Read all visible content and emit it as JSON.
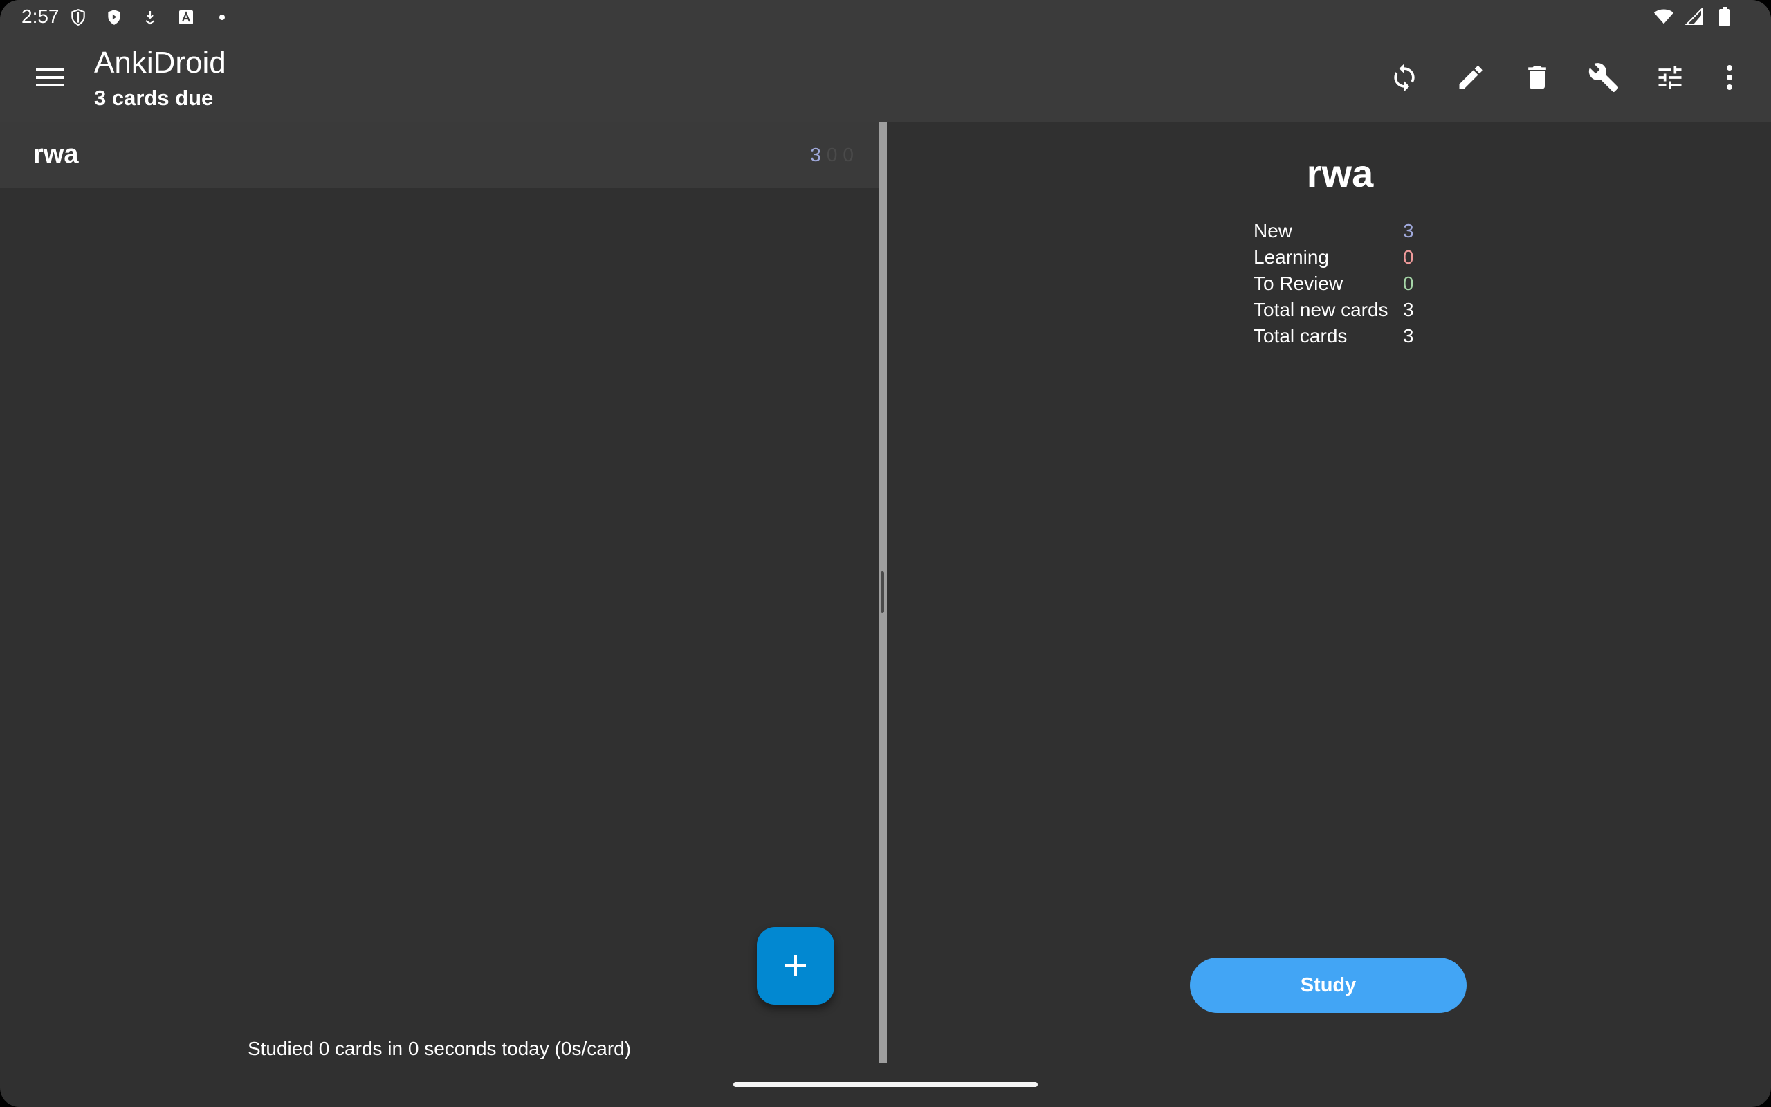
{
  "status_bar": {
    "time": "2:57",
    "left_icons": [
      "vpn-shield-icon",
      "play-protect-icon",
      "download-arrow-icon",
      "font-a-icon",
      "dot-icon"
    ],
    "right_icons": [
      "wifi-icon",
      "cell-signal-icon",
      "battery-icon"
    ]
  },
  "app_bar": {
    "title": "AnkiDroid",
    "subtitle": "3 cards due",
    "actions": [
      "sync-icon",
      "edit-icon",
      "delete-icon",
      "wrench-icon",
      "tune-icon",
      "more-vert-icon"
    ]
  },
  "deck_list": {
    "decks": [
      {
        "name": "rwa",
        "new": "3",
        "learning": "0",
        "review": "0"
      }
    ],
    "studied_text": "Studied 0 cards in 0 seconds today (0s/card)",
    "fab_label": "+"
  },
  "overview": {
    "title": "rwa",
    "stats": [
      {
        "label": "New",
        "value": "3",
        "color": "#9fa8da"
      },
      {
        "label": "Learning",
        "value": "0",
        "color": "#ef9a9a"
      },
      {
        "label": "To Review",
        "value": "0",
        "color": "#a5d6a7"
      },
      {
        "label": "Total new cards",
        "value": "3",
        "color": "#ffffff"
      },
      {
        "label": "Total cards",
        "value": "3",
        "color": "#ffffff"
      }
    ],
    "study_button": "Study"
  },
  "colors": {
    "accent": "#42a5f5",
    "fab": "#0288d1",
    "background": "#303030",
    "toolbar": "#3b3b3b"
  }
}
